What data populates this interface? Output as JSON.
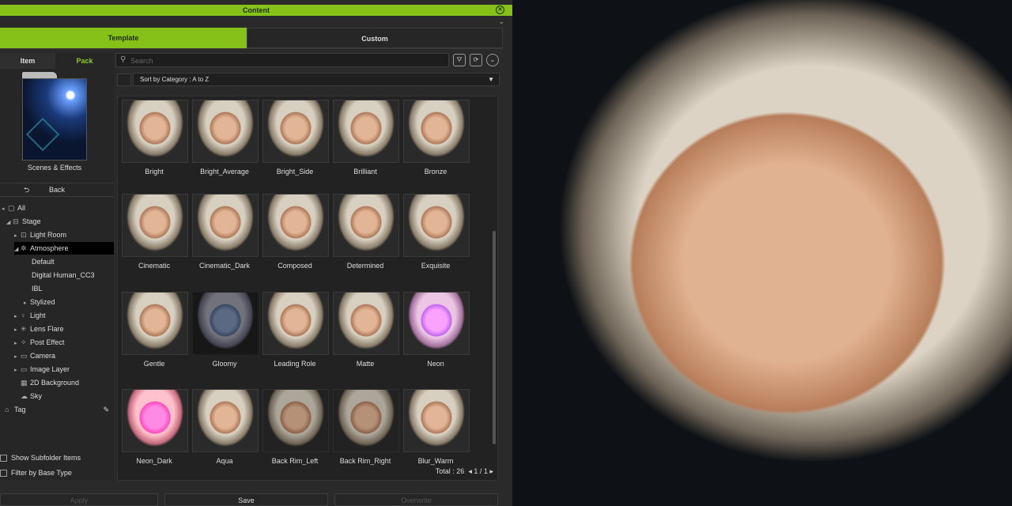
{
  "panel": {
    "title": "Content",
    "tabs": [
      "Template",
      "Custom"
    ],
    "subtabs": [
      "Item",
      "Pack"
    ],
    "folder_label": "Scenes & Effects",
    "back_label": "Back",
    "tree": [
      {
        "label": "All",
        "level": 0
      },
      {
        "label": "Stage",
        "level": 1
      },
      {
        "label": "Light Room",
        "level": 2
      },
      {
        "label": "Atmosphere",
        "level": 2
      },
      {
        "label": "Default",
        "level": 3
      },
      {
        "label": "Digital Human_CC3",
        "level": 3
      },
      {
        "label": "IBL",
        "level": 3
      },
      {
        "label": "Stylized",
        "level": 3
      },
      {
        "label": "Light",
        "level": 2
      },
      {
        "label": "Lens Flare",
        "level": 2
      },
      {
        "label": "Post Effect",
        "level": 2
      },
      {
        "label": "Camera",
        "level": 2
      },
      {
        "label": "Image Layer",
        "level": 2
      },
      {
        "label": "2D Background",
        "level": 2
      },
      {
        "label": "Sky",
        "level": 2
      },
      {
        "label": "Tag",
        "level": 0
      }
    ],
    "checks": [
      "Show Subfolder Items",
      "Filter by Base Type"
    ],
    "search_placeholder": "Search",
    "sort_label": "Sort by Category : A to Z",
    "items": [
      "Bright",
      "Bright_Average",
      "Bright_Side",
      "Brilliant",
      "Bronze",
      "Cinematic",
      "Cinematic_Dark",
      "Composed",
      "Determined",
      "Exquisite",
      "Gentle",
      "Gloomy",
      "Leading Role",
      "Matte",
      "Neon",
      "Neon_Dark",
      "Aqua",
      "Back Rim_Left",
      "Back Rim_Right",
      "Blur_Warm"
    ],
    "total_label": "Total : 26",
    "page_current": "1",
    "page_sep": "/",
    "page_total": "1",
    "buttons": {
      "apply": "Apply",
      "save": "Save",
      "overwrite": "Overwrite"
    }
  }
}
